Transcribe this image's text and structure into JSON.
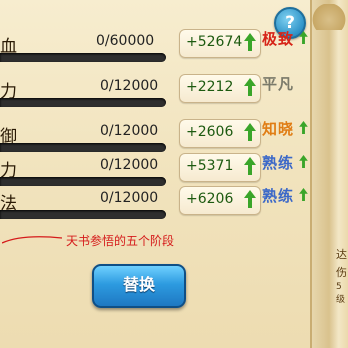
{
  "help": {
    "label": "?"
  },
  "stats": [
    {
      "name": "血",
      "value": "0/60000",
      "fill": 0,
      "bonus": "+52674",
      "rank": "极致",
      "rank_color": "#d62418"
    },
    {
      "name": "力",
      "value": "0/12000",
      "fill": 0,
      "bonus": "+2212",
      "rank": "平凡",
      "rank_color": "#7a7a6a"
    },
    {
      "name": "御",
      "value": "0/12000",
      "fill": 0,
      "bonus": "+2606",
      "rank": "知晓",
      "rank_color": "#e07d14"
    },
    {
      "name": "力",
      "value": "0/12000",
      "fill": 0,
      "bonus": "+5371",
      "rank": "熟练",
      "rank_color": "#3b68c8"
    },
    {
      "name": "法",
      "value": "0/12000",
      "fill": 0,
      "bonus": "+6206",
      "rank": "熟练",
      "rank_color": "#3b68c8"
    }
  ],
  "annotation": "天书参悟的五个阶段",
  "swap_button": {
    "label": "替换"
  },
  "side_text": [
    "达",
    "伤",
    "5级"
  ],
  "colors": {
    "up_arrow": "#3aa52a",
    "annotation": "#d51a1a",
    "button": "#2d9be0"
  }
}
